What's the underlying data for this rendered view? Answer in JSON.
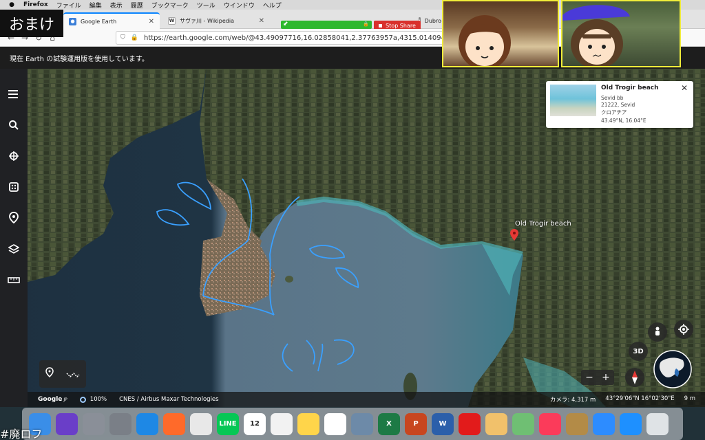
{
  "menubar": {
    "app": "Firefox",
    "items": [
      "ファイル",
      "編集",
      "表示",
      "履歴",
      "ブックマーク",
      "ツール",
      "ウインドウ",
      "ヘルプ"
    ]
  },
  "overlay": {
    "top_label": "おまけ",
    "bottom_label": "#廃ロフ"
  },
  "tabs": [
    {
      "label": "Google Earth",
      "active": true
    },
    {
      "label": "サヴァ川 - Wikipedia",
      "active": false
    },
    {
      "label": "Dubro",
      "active": false
    }
  ],
  "sharing": {
    "stop_label": "Stop Share"
  },
  "url": "https://earth.google.com/web/@43.49097716,16.02858041,2.37763957a,4315.01409454d,35y",
  "banner": "現在 Earth の試験運用版を使用しています。",
  "place_card": {
    "title": "Old Trogir beach",
    "line1": "Sevid bb",
    "line2": "21222, Sevid",
    "line3": "クロアチア",
    "coords": "43.49°N, 16.04°E"
  },
  "map": {
    "pin_label": "Old Trogir beach",
    "handwriting": "くじら",
    "view_3d": "3D"
  },
  "statusbar": {
    "logo": "Google",
    "logo_suffix": "JP",
    "percent": "100%",
    "credits": "CNES / Airbus   Maxar Technologies",
    "camera": "カメラ: 4,317 m",
    "coords": "43°29'06\"N 16°02'30\"E",
    "elevation": "9 m"
  },
  "dock": [
    {
      "name": "finder",
      "color": "#3a8ee8"
    },
    {
      "name": "siri",
      "color": "#6a3ec8"
    },
    {
      "name": "launchpad",
      "color": "#8a8f98"
    },
    {
      "name": "system-preferences",
      "color": "#7a7f87"
    },
    {
      "name": "safari",
      "color": "#1e88e5"
    },
    {
      "name": "firefox",
      "color": "#ff6a2a"
    },
    {
      "name": "chrome",
      "color": "#e8e8e8"
    },
    {
      "name": "line",
      "color": "#06c755",
      "label": "LINE"
    },
    {
      "name": "calendar",
      "color": "#ffffff",
      "label": "12"
    },
    {
      "name": "textedit",
      "color": "#f2f2f2"
    },
    {
      "name": "notes",
      "color": "#ffd54a"
    },
    {
      "name": "photos",
      "color": "#ffffff"
    },
    {
      "name": "preview",
      "color": "#6d8aa8"
    },
    {
      "name": "excel",
      "color": "#1d7a45",
      "label": "X"
    },
    {
      "name": "powerpoint",
      "color": "#c8461f",
      "label": "P"
    },
    {
      "name": "word",
      "color": "#2b5faa",
      "label": "W"
    },
    {
      "name": "acrobat",
      "color": "#e21b1b"
    },
    {
      "name": "keynote-pages",
      "color": "#f1c16b"
    },
    {
      "name": "maps",
      "color": "#6fbf73"
    },
    {
      "name": "music",
      "color": "#fb3b5a"
    },
    {
      "name": "garageband",
      "color": "#b38b47"
    },
    {
      "name": "zoom",
      "color": "#2d8cff"
    },
    {
      "name": "app-store",
      "color": "#1e90ff"
    },
    {
      "name": "trash",
      "color": "#dfe3e6"
    }
  ]
}
